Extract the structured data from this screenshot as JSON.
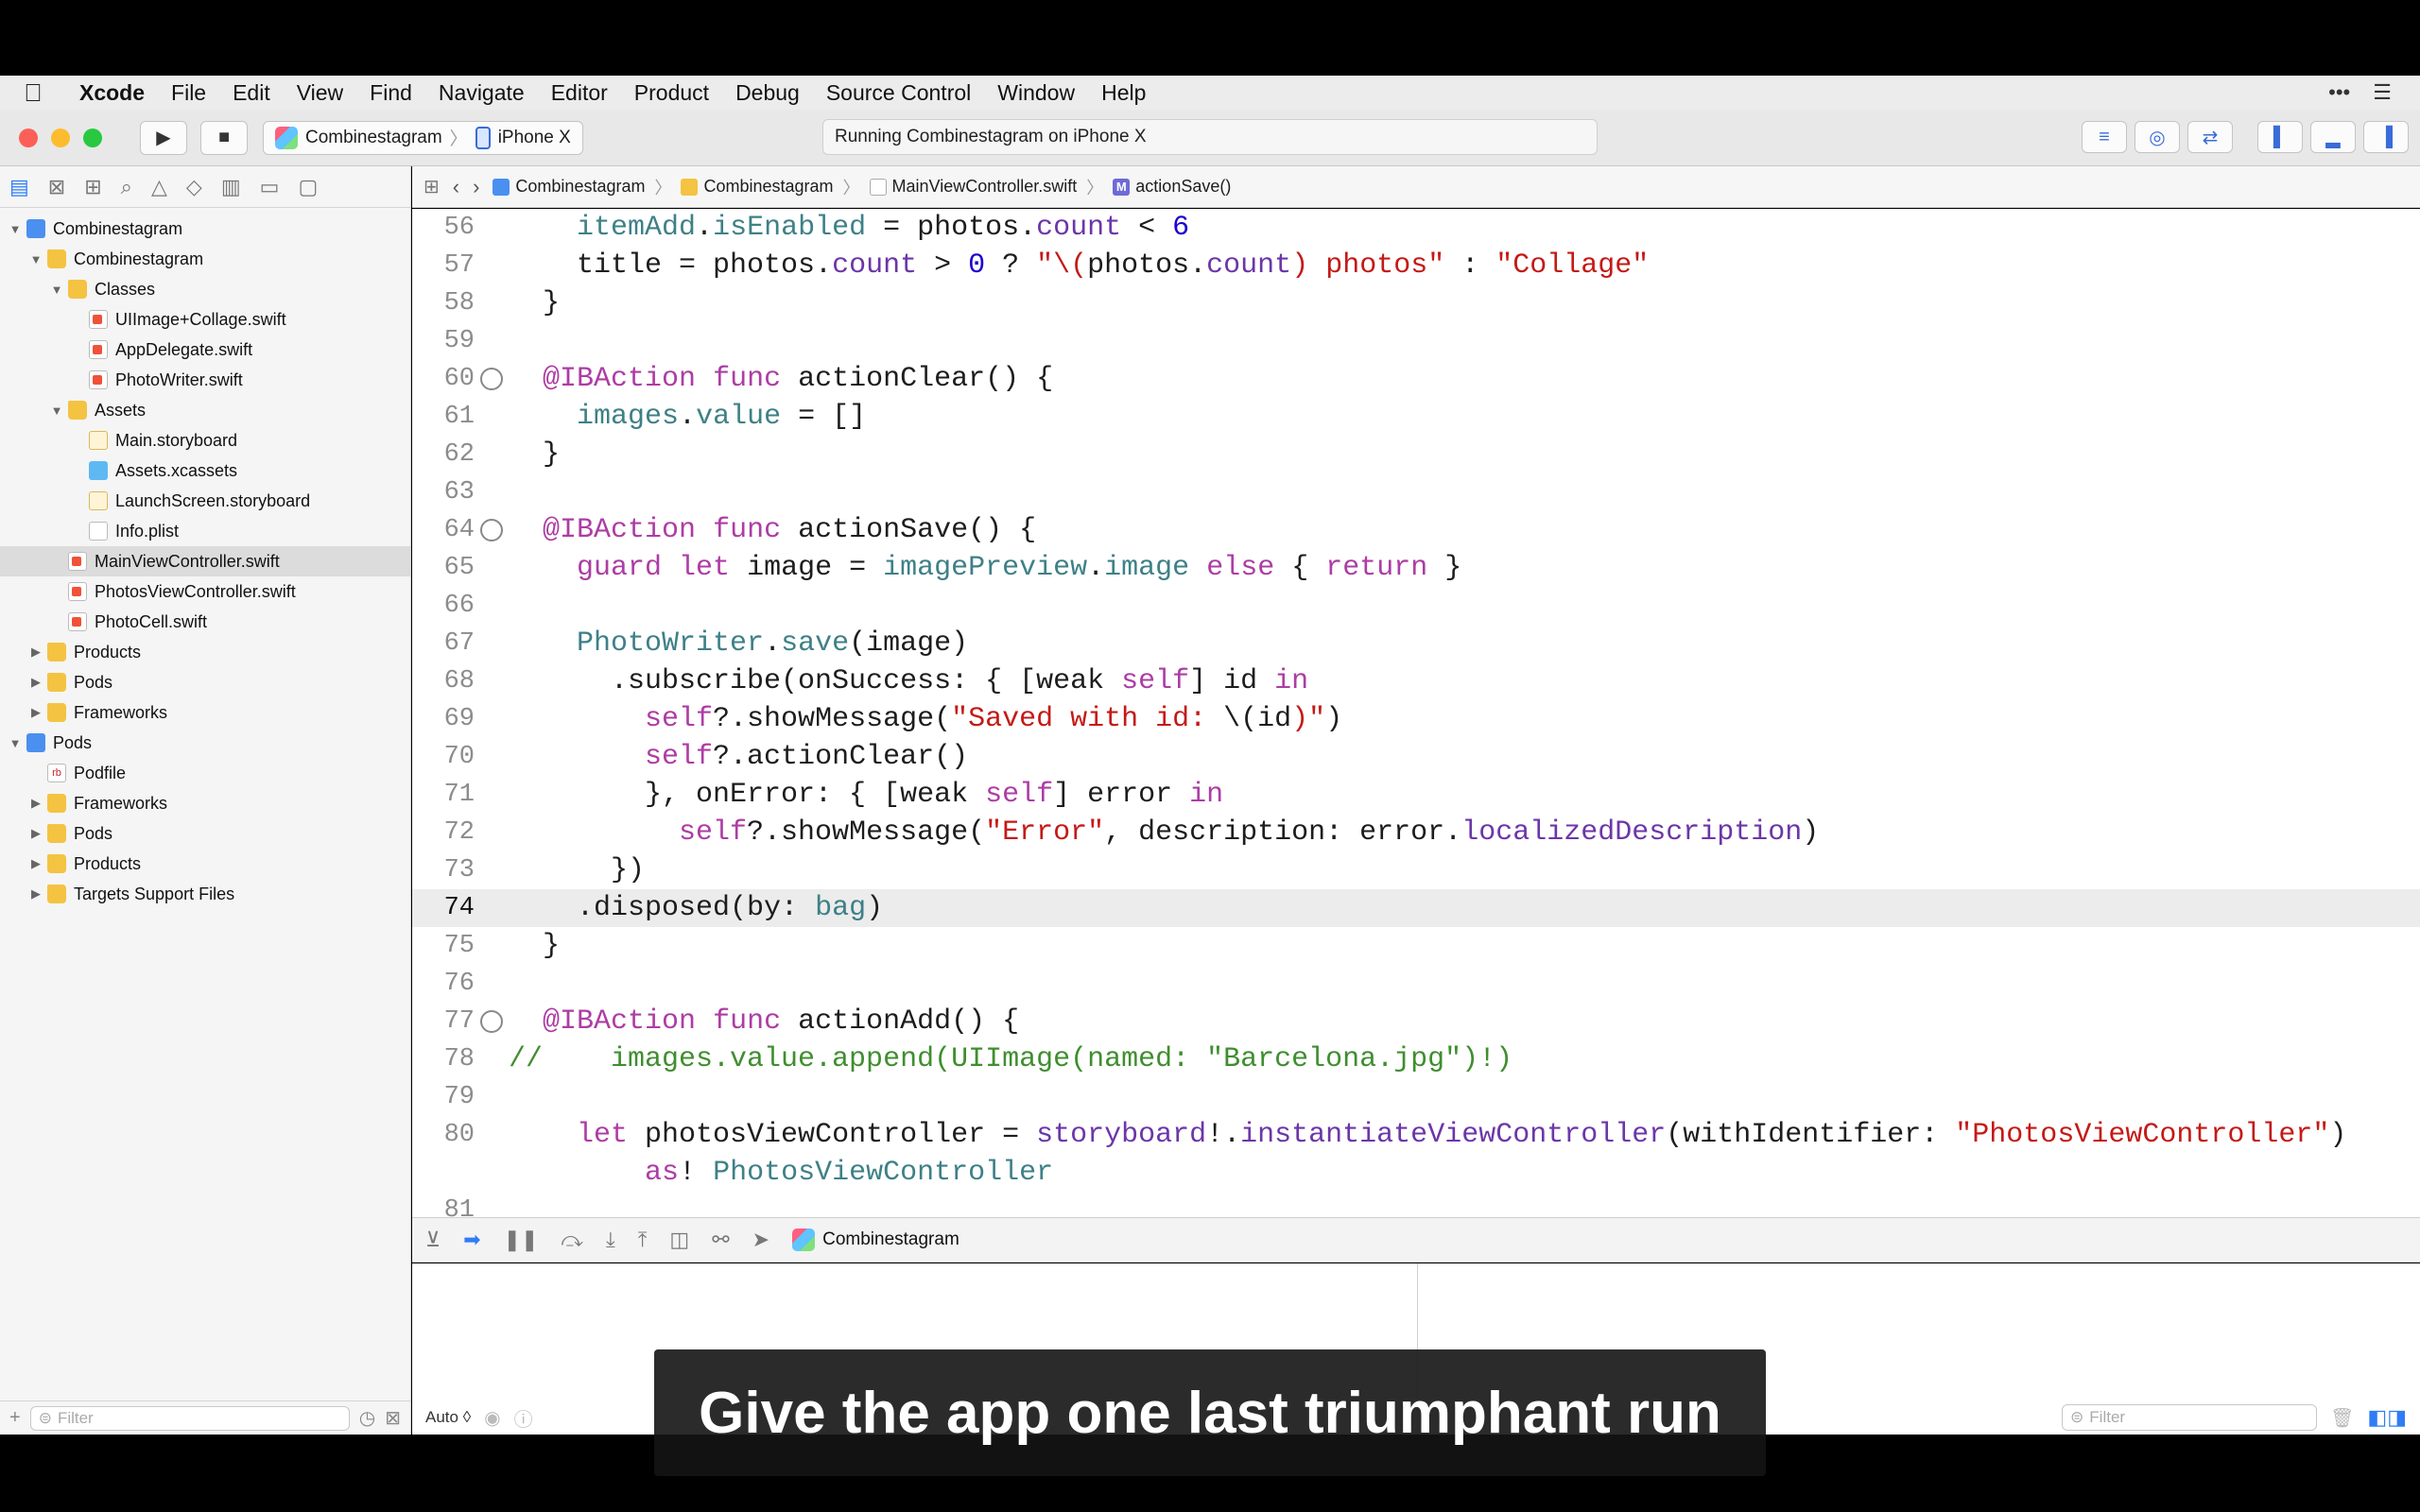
{
  "menubar": {
    "apple_icon": "apple-logo-icon",
    "items": [
      "Xcode",
      "File",
      "Edit",
      "View",
      "Find",
      "Navigate",
      "Editor",
      "Product",
      "Debug",
      "Source Control",
      "Window",
      "Help"
    ]
  },
  "toolbar": {
    "run_icon": "play-icon",
    "stop_icon": "stop-icon",
    "scheme": "Combinestagram",
    "device": "iPhone X",
    "activity_status": "Running Combinestagram on iPhone X"
  },
  "navigator": {
    "tabs": [
      "folder-icon",
      "source-control-icon",
      "symbol-icon",
      "search-icon",
      "issue-icon",
      "test-icon",
      "debug-icon",
      "breakpoint-icon",
      "report-icon"
    ],
    "tree": [
      {
        "label": "Combinestagram",
        "icon": "project",
        "depth": 0,
        "disclosure": "open"
      },
      {
        "label": "Combinestagram",
        "icon": "folder",
        "depth": 1,
        "disclosure": "open"
      },
      {
        "label": "Classes",
        "icon": "folder",
        "depth": 2,
        "disclosure": "open"
      },
      {
        "label": "UIImage+Collage.swift",
        "icon": "swift",
        "depth": 3,
        "disclosure": ""
      },
      {
        "label": "AppDelegate.swift",
        "icon": "swift",
        "depth": 3,
        "disclosure": ""
      },
      {
        "label": "PhotoWriter.swift",
        "icon": "swift",
        "depth": 3,
        "disclosure": ""
      },
      {
        "label": "Assets",
        "icon": "folder",
        "depth": 2,
        "disclosure": "open"
      },
      {
        "label": "Main.storyboard",
        "icon": "storyboard",
        "depth": 3,
        "disclosure": ""
      },
      {
        "label": "Assets.xcassets",
        "icon": "xcassets",
        "depth": 3,
        "disclosure": ""
      },
      {
        "label": "LaunchScreen.storyboard",
        "icon": "storyboard",
        "depth": 3,
        "disclosure": ""
      },
      {
        "label": "Info.plist",
        "icon": "plist",
        "depth": 3,
        "disclosure": ""
      },
      {
        "label": "MainViewController.swift",
        "icon": "swift",
        "depth": 2,
        "disclosure": "",
        "selected": true
      },
      {
        "label": "PhotosViewController.swift",
        "icon": "swift",
        "depth": 2,
        "disclosure": ""
      },
      {
        "label": "PhotoCell.swift",
        "icon": "swift",
        "depth": 2,
        "disclosure": ""
      },
      {
        "label": "Products",
        "icon": "folder",
        "depth": 1,
        "disclosure": "closed"
      },
      {
        "label": "Pods",
        "icon": "folder",
        "depth": 1,
        "disclosure": "closed"
      },
      {
        "label": "Frameworks",
        "icon": "folder",
        "depth": 1,
        "disclosure": "closed"
      },
      {
        "label": "Pods",
        "icon": "project",
        "depth": 0,
        "disclosure": "open"
      },
      {
        "label": "Podfile",
        "icon": "rb",
        "depth": 1,
        "disclosure": ""
      },
      {
        "label": "Frameworks",
        "icon": "folder",
        "depth": 1,
        "disclosure": "closed"
      },
      {
        "label": "Pods",
        "icon": "folder",
        "depth": 1,
        "disclosure": "closed"
      },
      {
        "label": "Products",
        "icon": "folder",
        "depth": 1,
        "disclosure": "closed"
      },
      {
        "label": "Targets Support Files",
        "icon": "folder",
        "depth": 1,
        "disclosure": "closed"
      }
    ],
    "filter_placeholder": "Filter",
    "add_label": "+"
  },
  "jumpbar": {
    "crumbs": [
      {
        "label": "Combinestagram",
        "icon": "project"
      },
      {
        "label": "Combinestagram",
        "icon": "folder"
      },
      {
        "label": "MainViewController.swift",
        "icon": "swift"
      },
      {
        "label": "actionSave()",
        "icon": "method"
      }
    ],
    "method_badge": "M"
  },
  "editor": {
    "current_line": 74,
    "lines": [
      {
        "n": 56,
        "marker": false,
        "tokens": [
          {
            "t": "    "
          },
          {
            "t": "itemAdd",
            "c": "#3e8087"
          },
          {
            "t": "."
          },
          {
            "t": "isEnabled",
            "c": "#3e8087"
          },
          {
            "t": " = photos."
          },
          {
            "t": "count",
            "c": "#6c36a9"
          },
          {
            "t": " < "
          },
          {
            "t": "6",
            "c": "#1c00cf"
          }
        ]
      },
      {
        "n": 57,
        "marker": false,
        "tokens": [
          {
            "t": "    title = photos."
          },
          {
            "t": "count",
            "c": "#6c36a9"
          },
          {
            "t": " > "
          },
          {
            "t": "0",
            "c": "#1c00cf"
          },
          {
            "t": " ? "
          },
          {
            "t": "\"\\(",
            "c": "#c41a16"
          },
          {
            "t": "photos."
          },
          {
            "t": "count",
            "c": "#6c36a9"
          },
          {
            "t": ")",
            "c": "#c41a16"
          },
          {
            "t": " photos\"",
            "c": "#c41a16"
          },
          {
            "t": " : "
          },
          {
            "t": "\"Collage\"",
            "c": "#c41a16"
          }
        ]
      },
      {
        "n": 58,
        "marker": false,
        "tokens": [
          {
            "t": "  }"
          }
        ]
      },
      {
        "n": 59,
        "marker": false,
        "tokens": [
          {
            "t": ""
          }
        ]
      },
      {
        "n": 60,
        "marker": true,
        "tokens": [
          {
            "t": "  "
          },
          {
            "t": "@IBAction",
            "c": "#ad3da4"
          },
          {
            "t": " "
          },
          {
            "t": "func",
            "c": "#ad3da4"
          },
          {
            "t": " actionClear() {"
          }
        ]
      },
      {
        "n": 61,
        "marker": false,
        "tokens": [
          {
            "t": "    "
          },
          {
            "t": "images",
            "c": "#3e8087"
          },
          {
            "t": "."
          },
          {
            "t": "value",
            "c": "#3e8087"
          },
          {
            "t": " = []"
          }
        ]
      },
      {
        "n": 62,
        "marker": false,
        "tokens": [
          {
            "t": "  }"
          }
        ]
      },
      {
        "n": 63,
        "marker": false,
        "tokens": [
          {
            "t": ""
          }
        ]
      },
      {
        "n": 64,
        "marker": true,
        "tokens": [
          {
            "t": "  "
          },
          {
            "t": "@IBAction",
            "c": "#ad3da4"
          },
          {
            "t": " "
          },
          {
            "t": "func",
            "c": "#ad3da4"
          },
          {
            "t": " actionSave() {"
          }
        ]
      },
      {
        "n": 65,
        "marker": false,
        "tokens": [
          {
            "t": "    "
          },
          {
            "t": "guard",
            "c": "#ad3da4"
          },
          {
            "t": " "
          },
          {
            "t": "let",
            "c": "#ad3da4"
          },
          {
            "t": " image = "
          },
          {
            "t": "imagePreview",
            "c": "#3e8087"
          },
          {
            "t": "."
          },
          {
            "t": "image",
            "c": "#3e8087"
          },
          {
            "t": " "
          },
          {
            "t": "else",
            "c": "#ad3da4"
          },
          {
            "t": " { "
          },
          {
            "t": "return",
            "c": "#ad3da4"
          },
          {
            "t": " }"
          }
        ]
      },
      {
        "n": 66,
        "marker": false,
        "tokens": [
          {
            "t": ""
          }
        ]
      },
      {
        "n": 67,
        "marker": false,
        "tokens": [
          {
            "t": "    "
          },
          {
            "t": "PhotoWriter",
            "c": "#3e8087"
          },
          {
            "t": "."
          },
          {
            "t": "save",
            "c": "#3e8087"
          },
          {
            "t": "(image)"
          }
        ]
      },
      {
        "n": 68,
        "marker": false,
        "tokens": [
          {
            "t": "      .subscribe(onSuccess: { [weak "
          },
          {
            "t": "self",
            "c": "#ad3da4"
          },
          {
            "t": "] id "
          },
          {
            "t": "in",
            "c": "#ad3da4"
          }
        ]
      },
      {
        "n": 69,
        "marker": false,
        "tokens": [
          {
            "t": "        "
          },
          {
            "t": "self",
            "c": "#ad3da4"
          },
          {
            "t": "?.showMessage("
          },
          {
            "t": "\"Saved with id: ",
            "c": "#c41a16"
          },
          {
            "t": "\\("
          },
          {
            "t": "id"
          },
          {
            "t": ")\"",
            "c": "#c41a16"
          },
          {
            "t": ")"
          }
        ]
      },
      {
        "n": 70,
        "marker": false,
        "tokens": [
          {
            "t": "        "
          },
          {
            "t": "self",
            "c": "#ad3da4"
          },
          {
            "t": "?.actionClear()"
          }
        ]
      },
      {
        "n": 71,
        "marker": false,
        "tokens": [
          {
            "t": "        }, onError: { [weak "
          },
          {
            "t": "self",
            "c": "#ad3da4"
          },
          {
            "t": "] error "
          },
          {
            "t": "in",
            "c": "#ad3da4"
          }
        ]
      },
      {
        "n": 72,
        "marker": false,
        "tokens": [
          {
            "t": "          "
          },
          {
            "t": "self",
            "c": "#ad3da4"
          },
          {
            "t": "?.showMessage("
          },
          {
            "t": "\"Error\"",
            "c": "#c41a16"
          },
          {
            "t": ", description: error."
          },
          {
            "t": "localizedDescription",
            "c": "#6c36a9"
          },
          {
            "t": ")"
          }
        ]
      },
      {
        "n": 73,
        "marker": false,
        "tokens": [
          {
            "t": "      })"
          }
        ]
      },
      {
        "n": 74,
        "marker": false,
        "tokens": [
          {
            "t": "    .disposed(by: "
          },
          {
            "t": "bag",
            "c": "#3e8087"
          },
          {
            "t": ")"
          }
        ]
      },
      {
        "n": 75,
        "marker": false,
        "tokens": [
          {
            "t": "  }"
          }
        ]
      },
      {
        "n": 76,
        "marker": false,
        "tokens": [
          {
            "t": ""
          }
        ]
      },
      {
        "n": 77,
        "marker": true,
        "tokens": [
          {
            "t": "  "
          },
          {
            "t": "@IBAction",
            "c": "#ad3da4"
          },
          {
            "t": " "
          },
          {
            "t": "func",
            "c": "#ad3da4"
          },
          {
            "t": " actionAdd() {"
          }
        ]
      },
      {
        "n": 78,
        "marker": false,
        "tokens": [
          {
            "t": "//    images.value.append(UIImage(named: \"Barcelona.jpg\")!)",
            "c": "#3f8e2f"
          }
        ]
      },
      {
        "n": 79,
        "marker": false,
        "tokens": [
          {
            "t": ""
          }
        ]
      },
      {
        "n": 80,
        "marker": false,
        "tokens": [
          {
            "t": "    "
          },
          {
            "t": "let",
            "c": "#ad3da4"
          },
          {
            "t": " photosViewController = "
          },
          {
            "t": "storyboard",
            "c": "#6c36a9"
          },
          {
            "t": "!."
          },
          {
            "t": "instantiateViewController",
            "c": "#6c36a9"
          },
          {
            "t": "(withIdentifier: "
          },
          {
            "t": "\"PhotosViewController\"",
            "c": "#c41a16"
          },
          {
            "t": ")"
          }
        ]
      },
      {
        "n": "",
        "marker": false,
        "tokens": [
          {
            "t": "        "
          },
          {
            "t": "as",
            "c": "#ad3da4"
          },
          {
            "t": "! "
          },
          {
            "t": "PhotosViewController",
            "c": "#3e8087"
          }
        ]
      },
      {
        "n": 81,
        "marker": false,
        "tokens": [
          {
            "t": ""
          }
        ]
      }
    ]
  },
  "debug": {
    "target": "Combinestagram",
    "auto_label": "Auto ◊",
    "filter_placeholder": "Filter"
  },
  "caption": "Give the app one last triumphant run"
}
